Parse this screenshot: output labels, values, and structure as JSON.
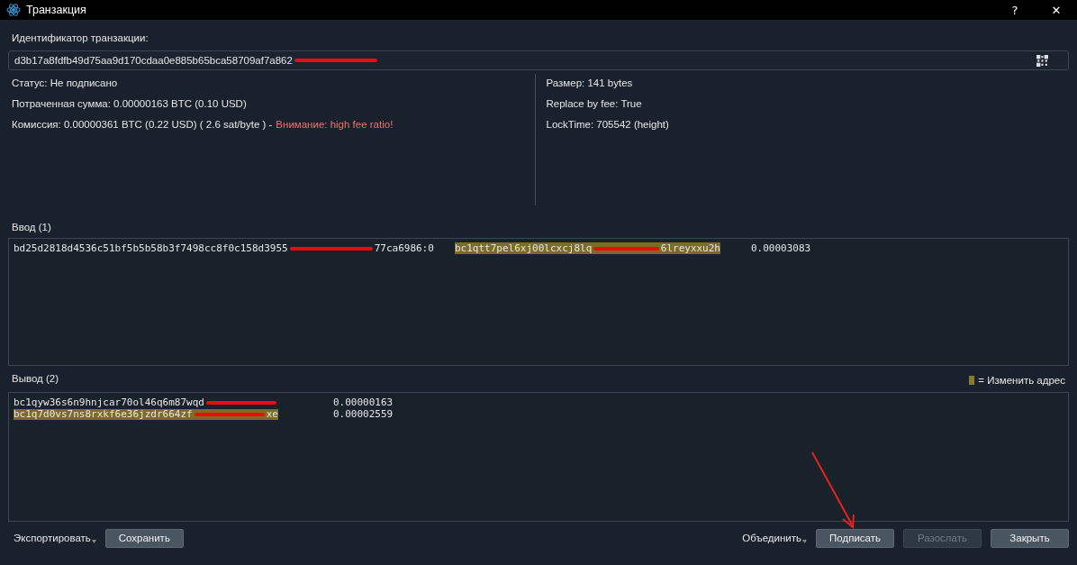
{
  "window": {
    "title": "Транзакция",
    "help": "?",
    "close": "✕"
  },
  "txid": {
    "label": "Идентификатор транзакции:",
    "value_start": "d3b17a8fdfb49d75aa9d170cdaa0e885b65bca58709af7a862",
    "redacted": true
  },
  "info_left": [
    {
      "text": "Статус: Не подписано"
    },
    {
      "text": "Потраченная сумма: 0.00000163 BTC (0.10 USD)"
    },
    {
      "text": "Комиссия: 0.00000361 BTC (0.22 USD) ( 2.6 sat/byte ) -",
      "warning": "Внимание: high fee ratio!"
    }
  ],
  "info_right": [
    {
      "text": "Размер: 141 bytes"
    },
    {
      "text": "Replace by fee: True"
    },
    {
      "text": "LockTime: 705542 (height)"
    }
  ],
  "inputs": {
    "title": "Ввод (1)",
    "rows": [
      {
        "outpoint_start": "bd25d2818d4536c51bf5b5b58b3f7498cc8f0c158d3955",
        "outpoint_end": "77ca6986:0",
        "address_start": "bc1qtt7pel6xj00lcxcj8lq",
        "address_end": "6lreyxxu2h",
        "change": true,
        "amount": "0.00003083"
      }
    ]
  },
  "outputs": {
    "title": "Вывод (2)",
    "legend": "= Изменить адрес",
    "rows": [
      {
        "address_start": "bc1qyw36s6n9hnjcar70ol46q6m87wqd",
        "change": false,
        "amount": "0.00000163"
      },
      {
        "address_start": "bc1q7d0vs7ns8rxkf6e36jzdr664zf",
        "address_end": "xe",
        "change": true,
        "amount": "0.00002559"
      }
    ]
  },
  "footer": {
    "left": [
      {
        "kind": "menu",
        "label": "Экспортировать"
      },
      {
        "kind": "button",
        "label": "Сохранить",
        "disabled": false
      }
    ],
    "right": [
      {
        "kind": "menu",
        "label": "Объединить"
      },
      {
        "kind": "button",
        "label": "Подписать",
        "disabled": false
      },
      {
        "kind": "button",
        "label": "Разослать",
        "disabled": true
      },
      {
        "kind": "button",
        "label": "Закрыть",
        "disabled": false
      }
    ]
  }
}
